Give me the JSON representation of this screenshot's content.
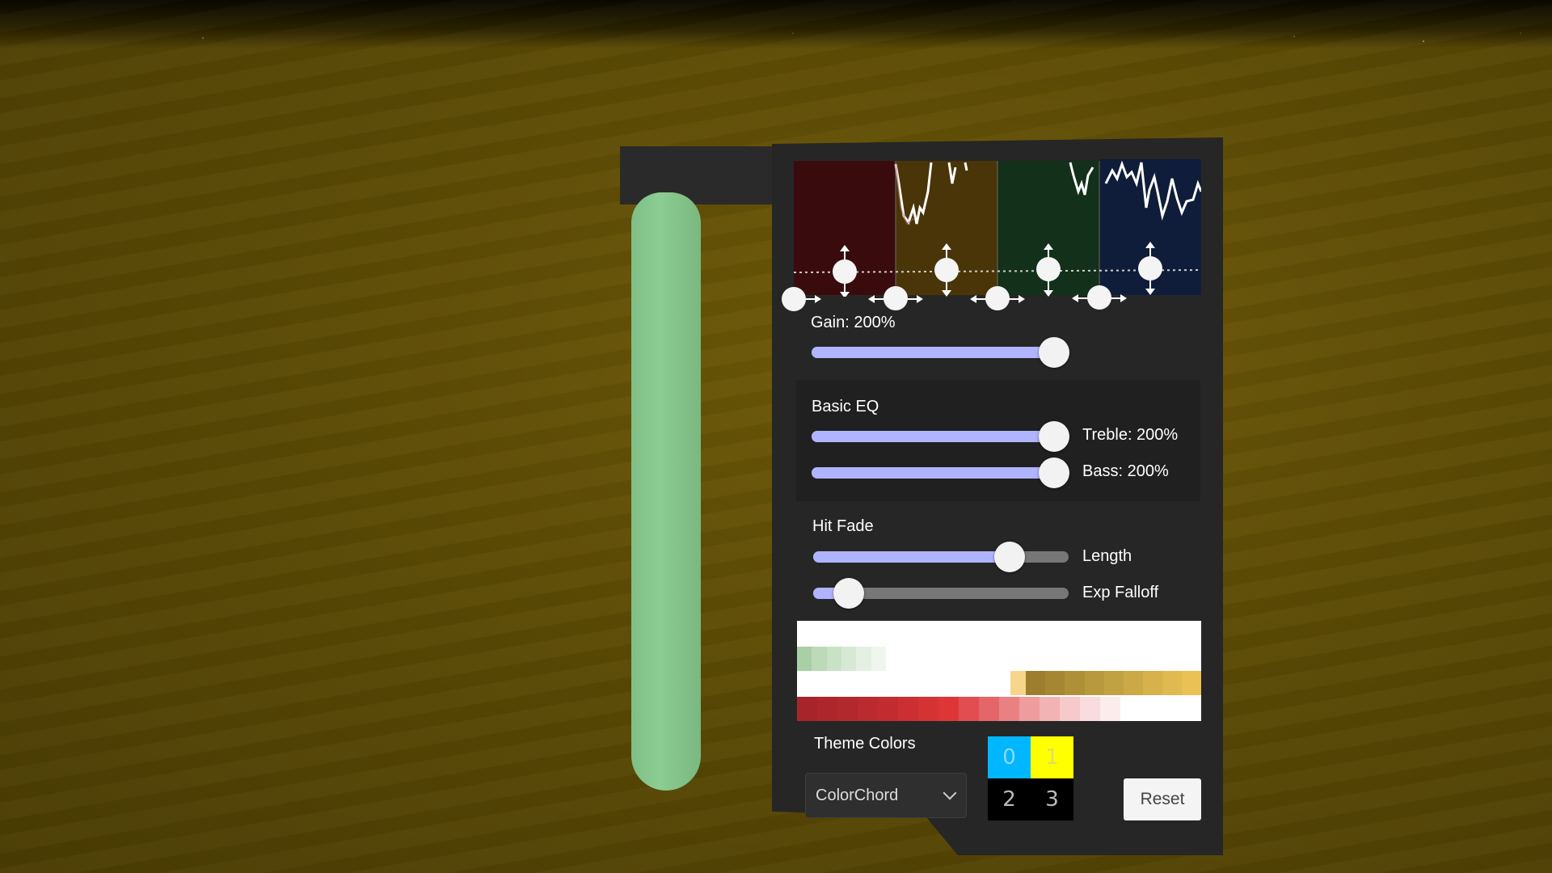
{
  "scene": {
    "ground_color": "#5c4b05",
    "tube_color": "#86c68c",
    "panel_color": "#262626"
  },
  "spectrum": {
    "bands": [
      {
        "color": "#3a0b0d"
      },
      {
        "color": "#4a3508"
      },
      {
        "color": "#12301a"
      },
      {
        "color": "#0f1d3a"
      }
    ]
  },
  "gain": {
    "label": "Gain: 200%",
    "value": 1.0
  },
  "basic_eq": {
    "title": "Basic EQ",
    "treble": {
      "label": "Treble: 200%",
      "value": 1.0
    },
    "bass": {
      "label": "Bass: 200%",
      "value": 1.0
    }
  },
  "hit_fade": {
    "title": "Hit Fade",
    "length": {
      "label": "Length",
      "value": 0.77
    },
    "exp_falloff": {
      "label": "Exp Falloff",
      "value": 0.14
    }
  },
  "theme": {
    "label": "Theme Colors",
    "selected": "ColorChord",
    "cells": [
      {
        "text": "0",
        "bg": "#00b7ff",
        "fg": "#8fd8ff"
      },
      {
        "text": "1",
        "bg": "#ffff00",
        "fg": "#e0e060"
      },
      {
        "text": "2",
        "bg": "#000000",
        "fg": "#bbbbbb"
      },
      {
        "text": "3",
        "bg": "#000000",
        "fg": "#bbbbbb"
      }
    ]
  },
  "reset_label": "Reset"
}
